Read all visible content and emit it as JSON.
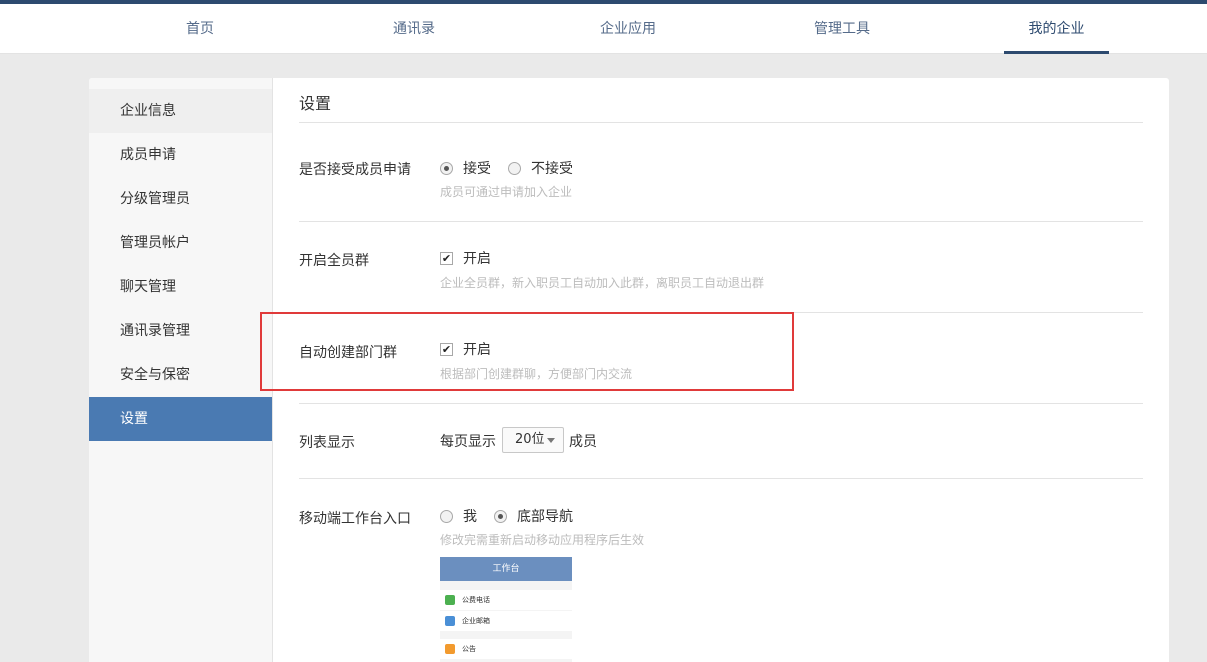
{
  "nav": {
    "items": [
      {
        "label": "首页"
      },
      {
        "label": "通讯录"
      },
      {
        "label": "企业应用"
      },
      {
        "label": "管理工具"
      },
      {
        "label": "我的企业",
        "active": true
      }
    ]
  },
  "sidebar": {
    "items": [
      {
        "label": "企业信息"
      },
      {
        "label": "成员申请"
      },
      {
        "label": "分级管理员"
      },
      {
        "label": "管理员帐户"
      },
      {
        "label": "聊天管理"
      },
      {
        "label": "通讯录管理"
      },
      {
        "label": "安全与保密"
      },
      {
        "label": "设置",
        "active": true
      }
    ]
  },
  "main": {
    "title": "设置",
    "member_apply": {
      "label": "是否接受成员申请",
      "options": [
        {
          "label": "接受",
          "selected": true
        },
        {
          "label": "不接受",
          "selected": false
        }
      ],
      "hint": "成员可通过申请加入企业"
    },
    "all_group": {
      "label": "开启全员群",
      "checkbox_label": "开启",
      "checked": true,
      "hint": "企业全员群，新入职员工自动加入此群，离职员工自动退出群"
    },
    "dept_group": {
      "label": "自动创建部门群",
      "checkbox_label": "开启",
      "checked": true,
      "hint": "根据部门创建群聊，方便部门内交流"
    },
    "list_display": {
      "label": "列表显示",
      "prefix": "每页显示",
      "value": "20位",
      "suffix": "成员"
    },
    "mobile_entry": {
      "label": "移动端工作台入口",
      "options": [
        {
          "label": "我",
          "selected": false
        },
        {
          "label": "底部导航",
          "selected": true
        }
      ],
      "hint": "修改完需重新启动移动应用程序后生效",
      "preview": {
        "header": "工作台",
        "rows": [
          {
            "label": "公费电话",
            "icon": "phone-icon",
            "color": "#4cb050"
          },
          {
            "label": "企业邮箱",
            "icon": "mail-icon",
            "color": "#4a8fd6"
          },
          {
            "label": "公告",
            "icon": "announcement-icon",
            "color": "#f29a2e"
          }
        ]
      }
    }
  },
  "colors": {
    "accent": "#4a7ab2",
    "nav_dark": "#2d4a6f",
    "highlight_box": "#e03a3a"
  }
}
